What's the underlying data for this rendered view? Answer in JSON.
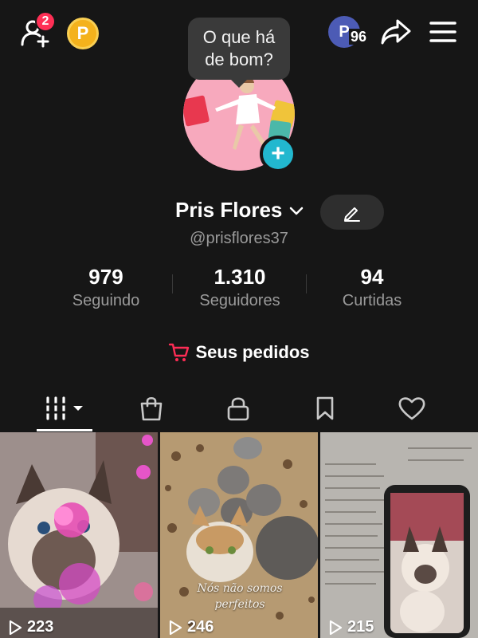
{
  "header": {
    "friend_requests_count": "2",
    "coin_label": "P",
    "viewer_initial": "P",
    "viewer_count": "96"
  },
  "bubble": {
    "text": "O que há de bom?"
  },
  "profile": {
    "name": "Pris Flores",
    "handle": "@prisflores37",
    "avatar_add_label": "+"
  },
  "stats": [
    {
      "value": "979",
      "label": "Seguindo"
    },
    {
      "value": "1.310",
      "label": "Seguidores"
    },
    {
      "value": "94",
      "label": "Curtidas"
    }
  ],
  "orders": {
    "label": "Seus pedidos"
  },
  "tabs": [
    {
      "icon": "grid-icon",
      "active": true
    },
    {
      "icon": "shopping-bag-icon",
      "active": false
    },
    {
      "icon": "lock-icon",
      "active": false
    },
    {
      "icon": "bookmark-icon",
      "active": false
    },
    {
      "icon": "heart-icon",
      "active": false
    }
  ],
  "videos": [
    {
      "views": "223"
    },
    {
      "views": "246",
      "caption": "Nós não somos perfeitos"
    },
    {
      "views": "215"
    }
  ],
  "colors": {
    "background": "#161616",
    "badge": "#ff2f55",
    "coin": "#f4b21c",
    "add_button": "#22b8cf",
    "cart": "#fe2c55",
    "muted_text": "#9a9a9a"
  }
}
